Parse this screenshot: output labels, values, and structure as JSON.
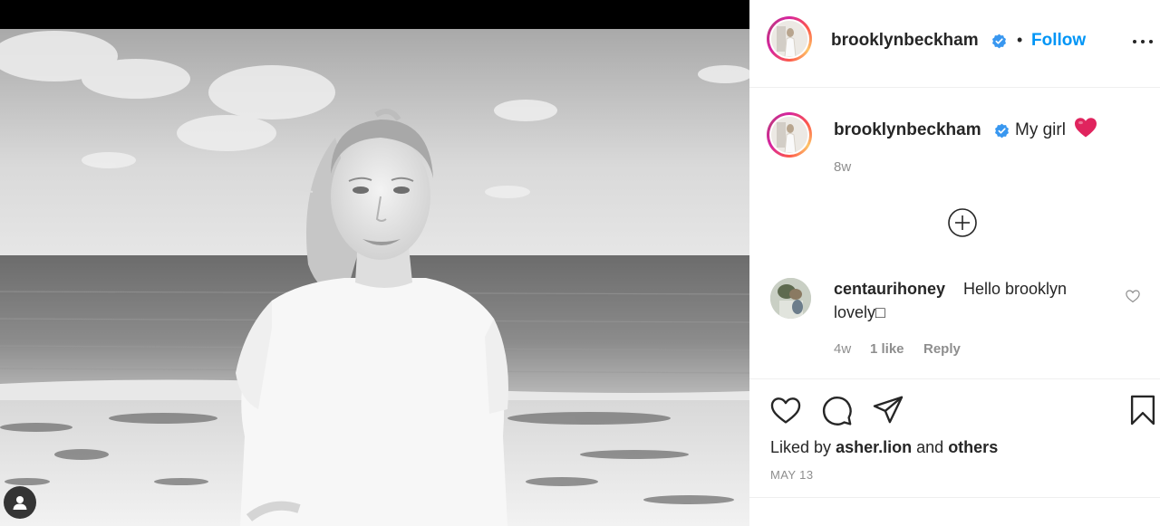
{
  "post": {
    "username": "brooklynbeckham",
    "follow_label": "Follow",
    "separator": "•",
    "caption": "My girl",
    "caption_time": "8w",
    "date": "MAY 13"
  },
  "comments": [
    {
      "username": "centaurihoney",
      "text_line1": "Hello brooklyn",
      "text_line2": "lovely□",
      "time": "4w",
      "likes": "1 like",
      "reply_label": "Reply"
    }
  ],
  "likes": {
    "prefix": "Liked by",
    "user": "asher.lion",
    "and": "and",
    "others": "others"
  },
  "icons": {
    "verified": "verified-badge-icon",
    "more": "more-options-icon",
    "load_more": "plus-circle-icon",
    "comment_like": "heart-outline-icon",
    "like": "heart-icon",
    "comment": "comment-icon",
    "share": "paper-plane-icon",
    "save": "bookmark-icon",
    "user_tag": "user-tag-icon"
  },
  "colors": {
    "accent": "#0095f6",
    "text": "#262626",
    "muted": "#8e8e8e",
    "divider": "#efefef",
    "heart_emoji": "#e0245e"
  }
}
